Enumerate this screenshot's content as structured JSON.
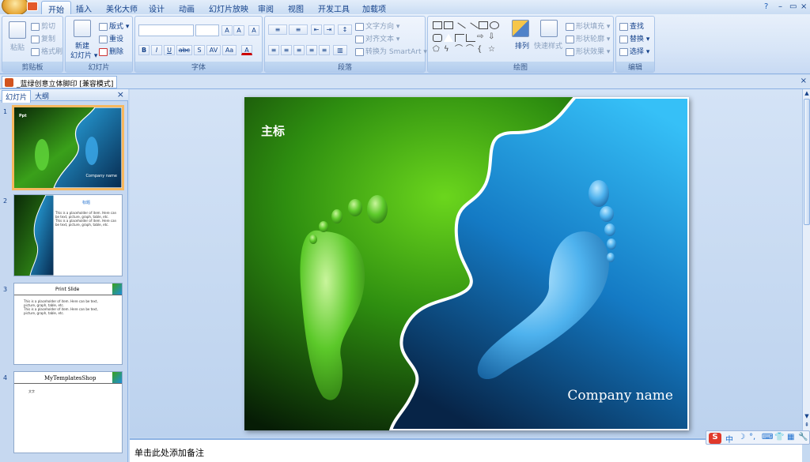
{
  "ribbon_tabs": [
    "开始",
    "插入",
    "美化大师",
    "设计",
    "动画",
    "幻灯片放映",
    "审阅",
    "视图",
    "开发工具",
    "加载项"
  ],
  "active_tab": "开始",
  "window_controls": {
    "help": "?",
    "minimize": "–",
    "restore": "▭",
    "close": "×"
  },
  "clipboard": {
    "paste": "粘贴",
    "cut": "剪切",
    "copy": "复制",
    "format_painter": "格式刷",
    "label": "剪贴板"
  },
  "slides_group": {
    "new_slide": "新建",
    "new_slide2": "幻灯片",
    "layout": "版式",
    "reset": "重设",
    "delete": "删除",
    "label": "幻灯片"
  },
  "font_group": {
    "label": "字体",
    "font_name": "",
    "font_size": "",
    "bold": "B",
    "italic": "I",
    "underline": "U",
    "strike": "abc",
    "shadow": "S",
    "spacing": "AV",
    "case": "Aa",
    "grow": "A",
    "shrink": "A",
    "clear": "A",
    "color": "A"
  },
  "paragraph_group": {
    "label": "段落",
    "text_direction": "文字方向",
    "align_text": "对齐文本",
    "convert_smartart": "转换为 SmartArt"
  },
  "drawing_group": {
    "label": "绘图",
    "arrange": "排列",
    "quick_styles": "快速样式",
    "shape_fill": "形状填充",
    "shape_outline": "形状轮廓",
    "shape_effects": "形状效果"
  },
  "editing_group": {
    "label": "编辑",
    "find": "查找",
    "replace": "替换",
    "select": "选择"
  },
  "document_tab": "_蓝绿创意立体脚印 [兼容模式]",
  "panel_tabs": [
    "幻灯片",
    "大纲"
  ],
  "thumbnails": [
    {
      "num": "1",
      "title": "Ppt",
      "company": "Company name"
    },
    {
      "num": "2",
      "title": "标题",
      "bullets": [
        "This is a placeholder of item. Here can be text, picture, graph, table, etc.",
        "This is a placeholder of item. Here can be text, picture, graph, table, etc."
      ]
    },
    {
      "num": "3",
      "title": "Print Slide",
      "bullets": [
        "This is a placeholder of item. Here can be text, picture, graph, table, etc.",
        "This is a placeholder of item. Here can be text, picture, graph, table, etc."
      ]
    },
    {
      "num": "4",
      "title": "MyTemplatesShop",
      "bullets": [
        "文字"
      ]
    }
  ],
  "slide": {
    "title": "主标",
    "company": "Company name"
  },
  "notes_placeholder": "单击此处添加备注",
  "ime": {
    "logo": "S",
    "lang": "中"
  },
  "colors": {
    "accent": "#15428b",
    "green": "#4fbf2a",
    "blue": "#1e8fd8",
    "selected_border": "#f7b85f"
  }
}
